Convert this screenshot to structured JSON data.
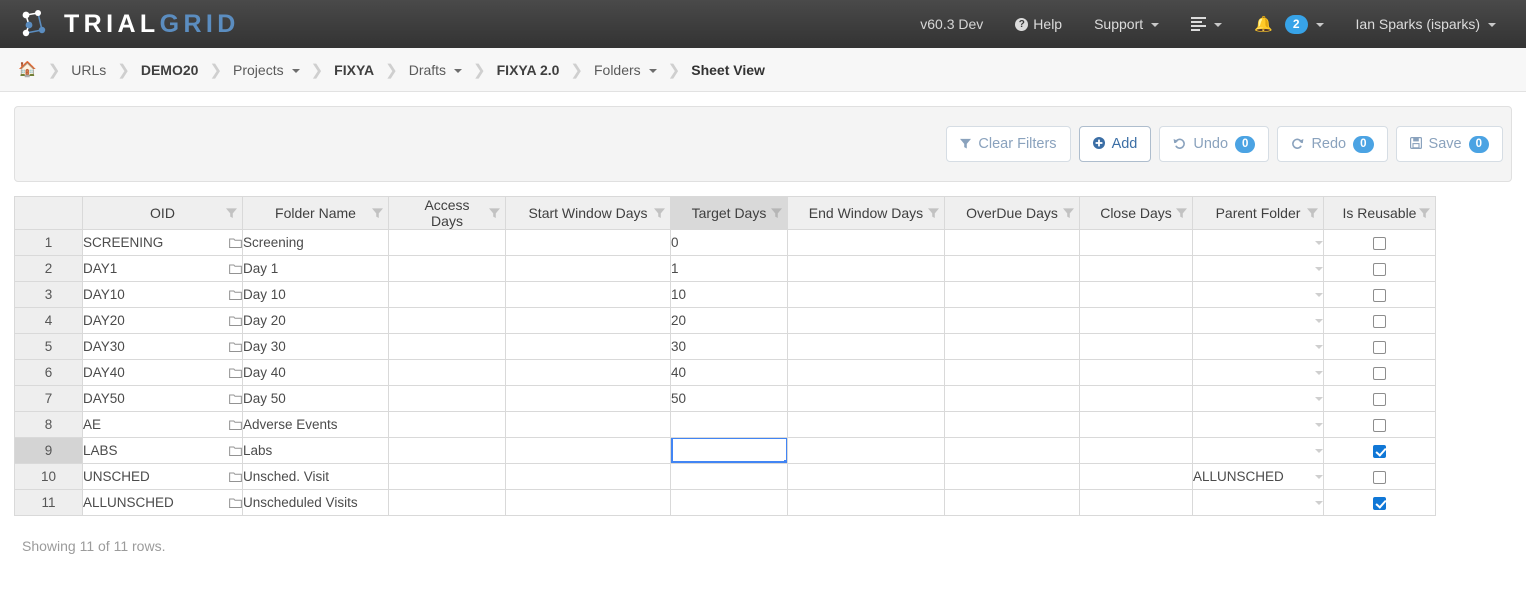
{
  "navbar": {
    "brand_primary": "TRIAL",
    "brand_secondary": "GRID",
    "version": "v60.3 Dev",
    "help": "Help",
    "support": "Support",
    "list_icon": "stacked-list-icon",
    "bell_icon": "bell-icon",
    "notification_count": "2",
    "user": "Ian Sparks (isparks)"
  },
  "breadcrumb": {
    "home_icon": "home-icon",
    "separator": "❯",
    "items": [
      {
        "label": "URLs",
        "bold": false,
        "caret": false
      },
      {
        "label": "DEMO20",
        "bold": true,
        "caret": false
      },
      {
        "label": "Projects",
        "bold": false,
        "caret": true
      },
      {
        "label": "FIXYA",
        "bold": true,
        "caret": false
      },
      {
        "label": "Drafts",
        "bold": false,
        "caret": true
      },
      {
        "label": "FIXYA 2.0",
        "bold": true,
        "caret": false
      },
      {
        "label": "Folders",
        "bold": false,
        "caret": true
      },
      {
        "label": "Sheet View",
        "bold": true,
        "caret": false,
        "current": true
      }
    ]
  },
  "toolbar": {
    "clear_filters_label": "Clear Filters",
    "clear_filters_icon": "filter-funnel-icon",
    "add_label": "Add",
    "add_icon": "plus-circle-icon",
    "undo_label": "Undo",
    "undo_icon": "undo-arrow-icon",
    "undo_count": "0",
    "redo_label": "Redo",
    "redo_icon": "redo-arrow-icon",
    "redo_count": "0",
    "save_label": "Save",
    "save_icon": "floppy-disk-icon",
    "save_count": "0"
  },
  "grid": {
    "columns": [
      {
        "label": "",
        "key": "rownum",
        "width": 68
      },
      {
        "label": "OID",
        "key": "oid",
        "width": 160
      },
      {
        "label": "Folder Name",
        "key": "folder_name",
        "width": 146
      },
      {
        "label": "Access Days",
        "key": "access_days",
        "width": 117
      },
      {
        "label": "Start Window Days",
        "key": "start_window_days",
        "width": 165
      },
      {
        "label": "Target Days",
        "key": "target_days",
        "width": 117,
        "active": true
      },
      {
        "label": "End Window Days",
        "key": "end_window_days",
        "width": 157
      },
      {
        "label": "OverDue Days",
        "key": "overdue_days",
        "width": 135
      },
      {
        "label": "Close Days",
        "key": "close_days",
        "width": 113
      },
      {
        "label": "Parent Folder",
        "key": "parent_folder",
        "width": 131
      },
      {
        "label": "Is Reusable",
        "key": "is_reusable",
        "width": 112
      }
    ],
    "filter_icon": "filter-funnel-icon",
    "folder_icon": "folder-icon",
    "rows": [
      {
        "rownum": "1",
        "oid": "SCREENING",
        "folder_name": "Screening",
        "access_days": "",
        "start_window_days": "",
        "target_days": "0",
        "end_window_days": "",
        "overdue_days": "",
        "close_days": "",
        "parent_folder": "",
        "is_reusable": false
      },
      {
        "rownum": "2",
        "oid": "DAY1",
        "folder_name": "Day 1",
        "access_days": "",
        "start_window_days": "",
        "target_days": "1",
        "end_window_days": "",
        "overdue_days": "",
        "close_days": "",
        "parent_folder": "",
        "is_reusable": false
      },
      {
        "rownum": "3",
        "oid": "DAY10",
        "folder_name": "Day 10",
        "access_days": "",
        "start_window_days": "",
        "target_days": "10",
        "end_window_days": "",
        "overdue_days": "",
        "close_days": "",
        "parent_folder": "",
        "is_reusable": false
      },
      {
        "rownum": "4",
        "oid": "DAY20",
        "folder_name": "Day 20",
        "access_days": "",
        "start_window_days": "",
        "target_days": "20",
        "end_window_days": "",
        "overdue_days": "",
        "close_days": "",
        "parent_folder": "",
        "is_reusable": false
      },
      {
        "rownum": "5",
        "oid": "DAY30",
        "folder_name": "Day 30",
        "access_days": "",
        "start_window_days": "",
        "target_days": "30",
        "end_window_days": "",
        "overdue_days": "",
        "close_days": "",
        "parent_folder": "",
        "is_reusable": false
      },
      {
        "rownum": "6",
        "oid": "DAY40",
        "folder_name": "Day 40",
        "access_days": "",
        "start_window_days": "",
        "target_days": "40",
        "end_window_days": "",
        "overdue_days": "",
        "close_days": "",
        "parent_folder": "",
        "is_reusable": false
      },
      {
        "rownum": "7",
        "oid": "DAY50",
        "folder_name": "Day 50",
        "access_days": "",
        "start_window_days": "",
        "target_days": "50",
        "end_window_days": "",
        "overdue_days": "",
        "close_days": "",
        "parent_folder": "",
        "is_reusable": false
      },
      {
        "rownum": "8",
        "oid": "AE",
        "folder_name": "Adverse Events",
        "access_days": "",
        "start_window_days": "",
        "target_days": "",
        "end_window_days": "",
        "overdue_days": "",
        "close_days": "",
        "parent_folder": "",
        "is_reusable": false
      },
      {
        "rownum": "9",
        "oid": "LABS",
        "folder_name": "Labs",
        "access_days": "",
        "start_window_days": "",
        "target_days": "",
        "end_window_days": "",
        "overdue_days": "",
        "close_days": "",
        "parent_folder": "",
        "is_reusable": true,
        "selected": true,
        "selected_cell": "target_days"
      },
      {
        "rownum": "10",
        "oid": "UNSCHED",
        "folder_name": "Unsched. Visit",
        "access_days": "",
        "start_window_days": "",
        "target_days": "",
        "end_window_days": "",
        "overdue_days": "",
        "close_days": "",
        "parent_folder": "ALLUNSCHED",
        "is_reusable": false
      },
      {
        "rownum": "11",
        "oid": "ALLUNSCHED",
        "folder_name": "Unscheduled Visits",
        "access_days": "",
        "start_window_days": "",
        "target_days": "",
        "end_window_days": "",
        "overdue_days": "",
        "close_days": "",
        "parent_folder": "",
        "is_reusable": true
      }
    ]
  },
  "footer": {
    "rows_summary": "Showing 11 of 11 rows."
  },
  "colors": {
    "accent_blue": "#37a3e8",
    "brand_blue": "#5b8dc0",
    "selection_blue": "#4285f4",
    "navbar_dark": "#3d3d3d"
  }
}
